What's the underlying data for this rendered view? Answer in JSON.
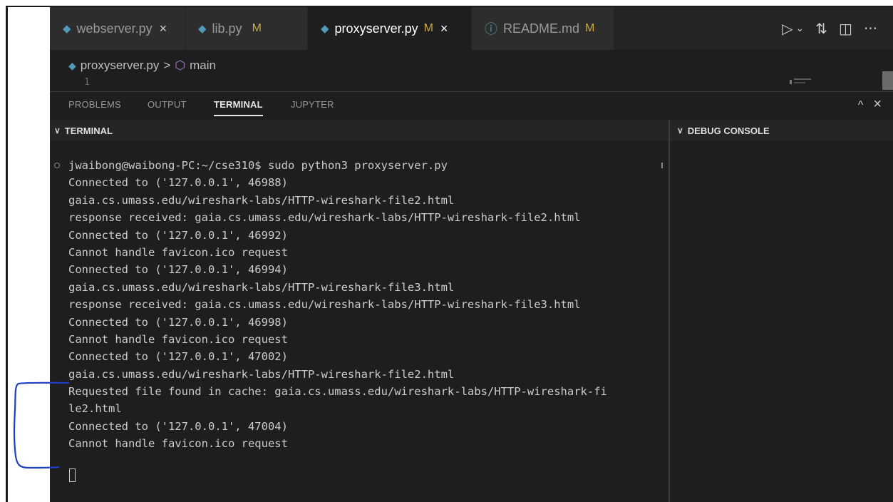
{
  "tabs": [
    {
      "label": "webserver.py",
      "icon": "python-file-icon",
      "modified": "",
      "close": "×",
      "active": false
    },
    {
      "label": "lib.py",
      "icon": "python-file-icon",
      "modified": "M",
      "close": "",
      "active": false
    },
    {
      "label": "proxyserver.py",
      "icon": "python-file-icon",
      "modified": "M",
      "close": "×",
      "active": true
    },
    {
      "label": "README.md",
      "icon": "info-icon",
      "modified": "M",
      "close": "",
      "active": false
    }
  ],
  "breadcrumb": {
    "file": "proxyserver.py",
    "separator": ">",
    "symbol": "main",
    "line_number": "1"
  },
  "panel": {
    "tabs": [
      "PROBLEMS",
      "OUTPUT",
      "TERMINAL",
      "JUPYTER"
    ],
    "active_tab": "TERMINAL",
    "terminal_header": "TERMINAL",
    "debug_header": "DEBUG CONSOLE"
  },
  "terminal": {
    "lines": [
      "jwaibong@waibong-PC:~/cse310$ sudo python3 proxyserver.py",
      "Connected to ('127.0.0.1', 46988)",
      "gaia.cs.umass.edu/wireshark-labs/HTTP-wireshark-file2.html",
      "response received: gaia.cs.umass.edu/wireshark-labs/HTTP-wireshark-file2.html",
      "Connected to ('127.0.0.1', 46992)",
      "Cannot handle favicon.ico request",
      "Connected to ('127.0.0.1', 46994)",
      "gaia.cs.umass.edu/wireshark-labs/HTTP-wireshark-file3.html",
      "response received: gaia.cs.umass.edu/wireshark-labs/HTTP-wireshark-file3.html",
      "Connected to ('127.0.0.1', 46998)",
      "Cannot handle favicon.ico request",
      "Connected to ('127.0.0.1', 47002)",
      "gaia.cs.umass.edu/wireshark-labs/HTTP-wireshark-file2.html",
      "Requested file found in cache: gaia.cs.umass.edu/wireshark-labs/HTTP-wireshark-fi",
      "le2.html",
      "Connected to ('127.0.0.1', 47004)",
      "Cannot handle favicon.ico request"
    ]
  },
  "icons": {
    "run": "▷",
    "run_dropdown": "⌄",
    "compare": "⇅",
    "split": "◫",
    "more": "···",
    "panel_up": "^",
    "panel_close": "×",
    "chevron": "∨",
    "breadcrumb_file": "◆",
    "breadcrumb_symbol": "⬡",
    "info": "ⓘ"
  },
  "colors": {
    "python_icon": "#519aba",
    "modified": "#c9a64a",
    "annotation": "#1f3fbf"
  }
}
